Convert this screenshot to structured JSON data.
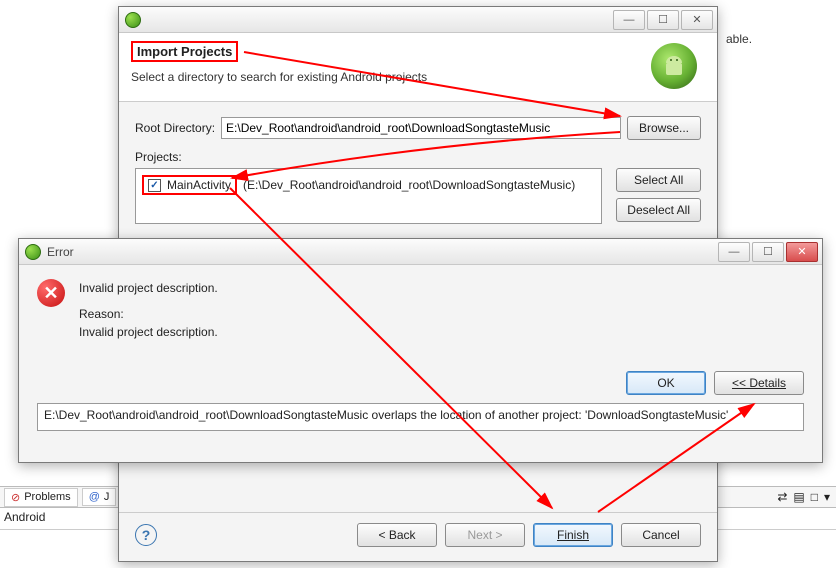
{
  "bg": {
    "partial_text": "able.",
    "tabs": {
      "problems": "Problems",
      "j": "J"
    },
    "input_value": "Android"
  },
  "import": {
    "window_title": "",
    "title": "Import Projects",
    "desc": "Select a directory to search for existing Android projects",
    "root_label": "Root Directory:",
    "root_value": "E:\\Dev_Root\\android\\android_root\\DownloadSongtasteMusic",
    "browse": "Browse...",
    "projects_label": "Projects:",
    "project_item_name": "MainActivity",
    "project_item_path": "(E:\\Dev_Root\\android\\android_root\\DownloadSongtasteMusic)",
    "select_all": "Select All",
    "deselect_all": "Deselect All",
    "back": "< Back",
    "next": "Next >",
    "finish": "Finish",
    "cancel": "Cancel"
  },
  "error": {
    "window_title": "Error",
    "heading": "Invalid project description.",
    "reason_label": "Reason:",
    "reason_text": "Invalid project description.",
    "ok": "OK",
    "details": "<< Details",
    "details_text": "E:\\Dev_Root\\android\\android_root\\DownloadSongtasteMusic overlaps the location of another project: 'DownloadSongtasteMusic'"
  },
  "win_ctrl": {
    "min": "—",
    "max": "☐",
    "close": "✕"
  }
}
